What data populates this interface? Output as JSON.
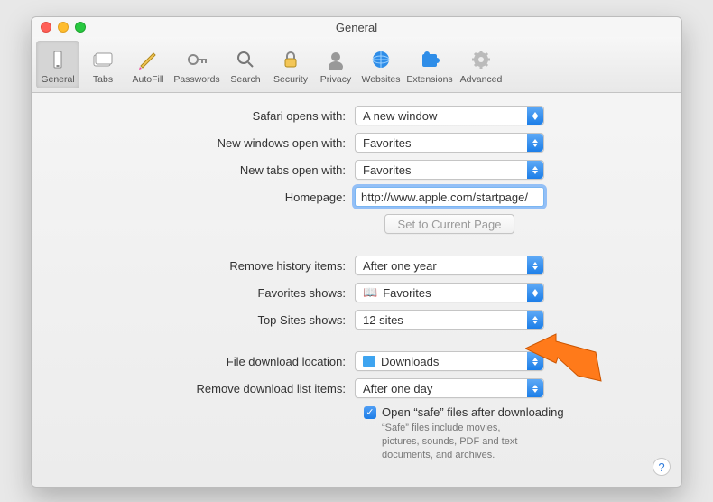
{
  "window": {
    "title": "General"
  },
  "toolbar": {
    "items": [
      {
        "label": "General"
      },
      {
        "label": "Tabs"
      },
      {
        "label": "AutoFill"
      },
      {
        "label": "Passwords"
      },
      {
        "label": "Search"
      },
      {
        "label": "Security"
      },
      {
        "label": "Privacy"
      },
      {
        "label": "Websites"
      },
      {
        "label": "Extensions"
      },
      {
        "label": "Advanced"
      }
    ]
  },
  "form": {
    "safari_opens_with_label": "Safari opens with:",
    "safari_opens_with_value": "A new window",
    "new_windows_label": "New windows open with:",
    "new_windows_value": "Favorites",
    "new_tabs_label": "New tabs open with:",
    "new_tabs_value": "Favorites",
    "homepage_label": "Homepage:",
    "homepage_value": "http://www.apple.com/startpage/",
    "set_current_page_label": "Set to Current Page",
    "remove_history_label": "Remove history items:",
    "remove_history_value": "After one year",
    "favorites_shows_label": "Favorites shows:",
    "favorites_shows_value": "Favorites",
    "top_sites_label": "Top Sites shows:",
    "top_sites_value": "12 sites",
    "download_location_label": "File download location:",
    "download_location_value": "Downloads",
    "remove_download_label": "Remove download list items:",
    "remove_download_value": "After one day",
    "open_safe_label": "Open “safe” files after downloading",
    "open_safe_help": "“Safe” files include movies, pictures, sounds, PDF and text documents, and archives."
  },
  "help": {
    "symbol": "?"
  }
}
